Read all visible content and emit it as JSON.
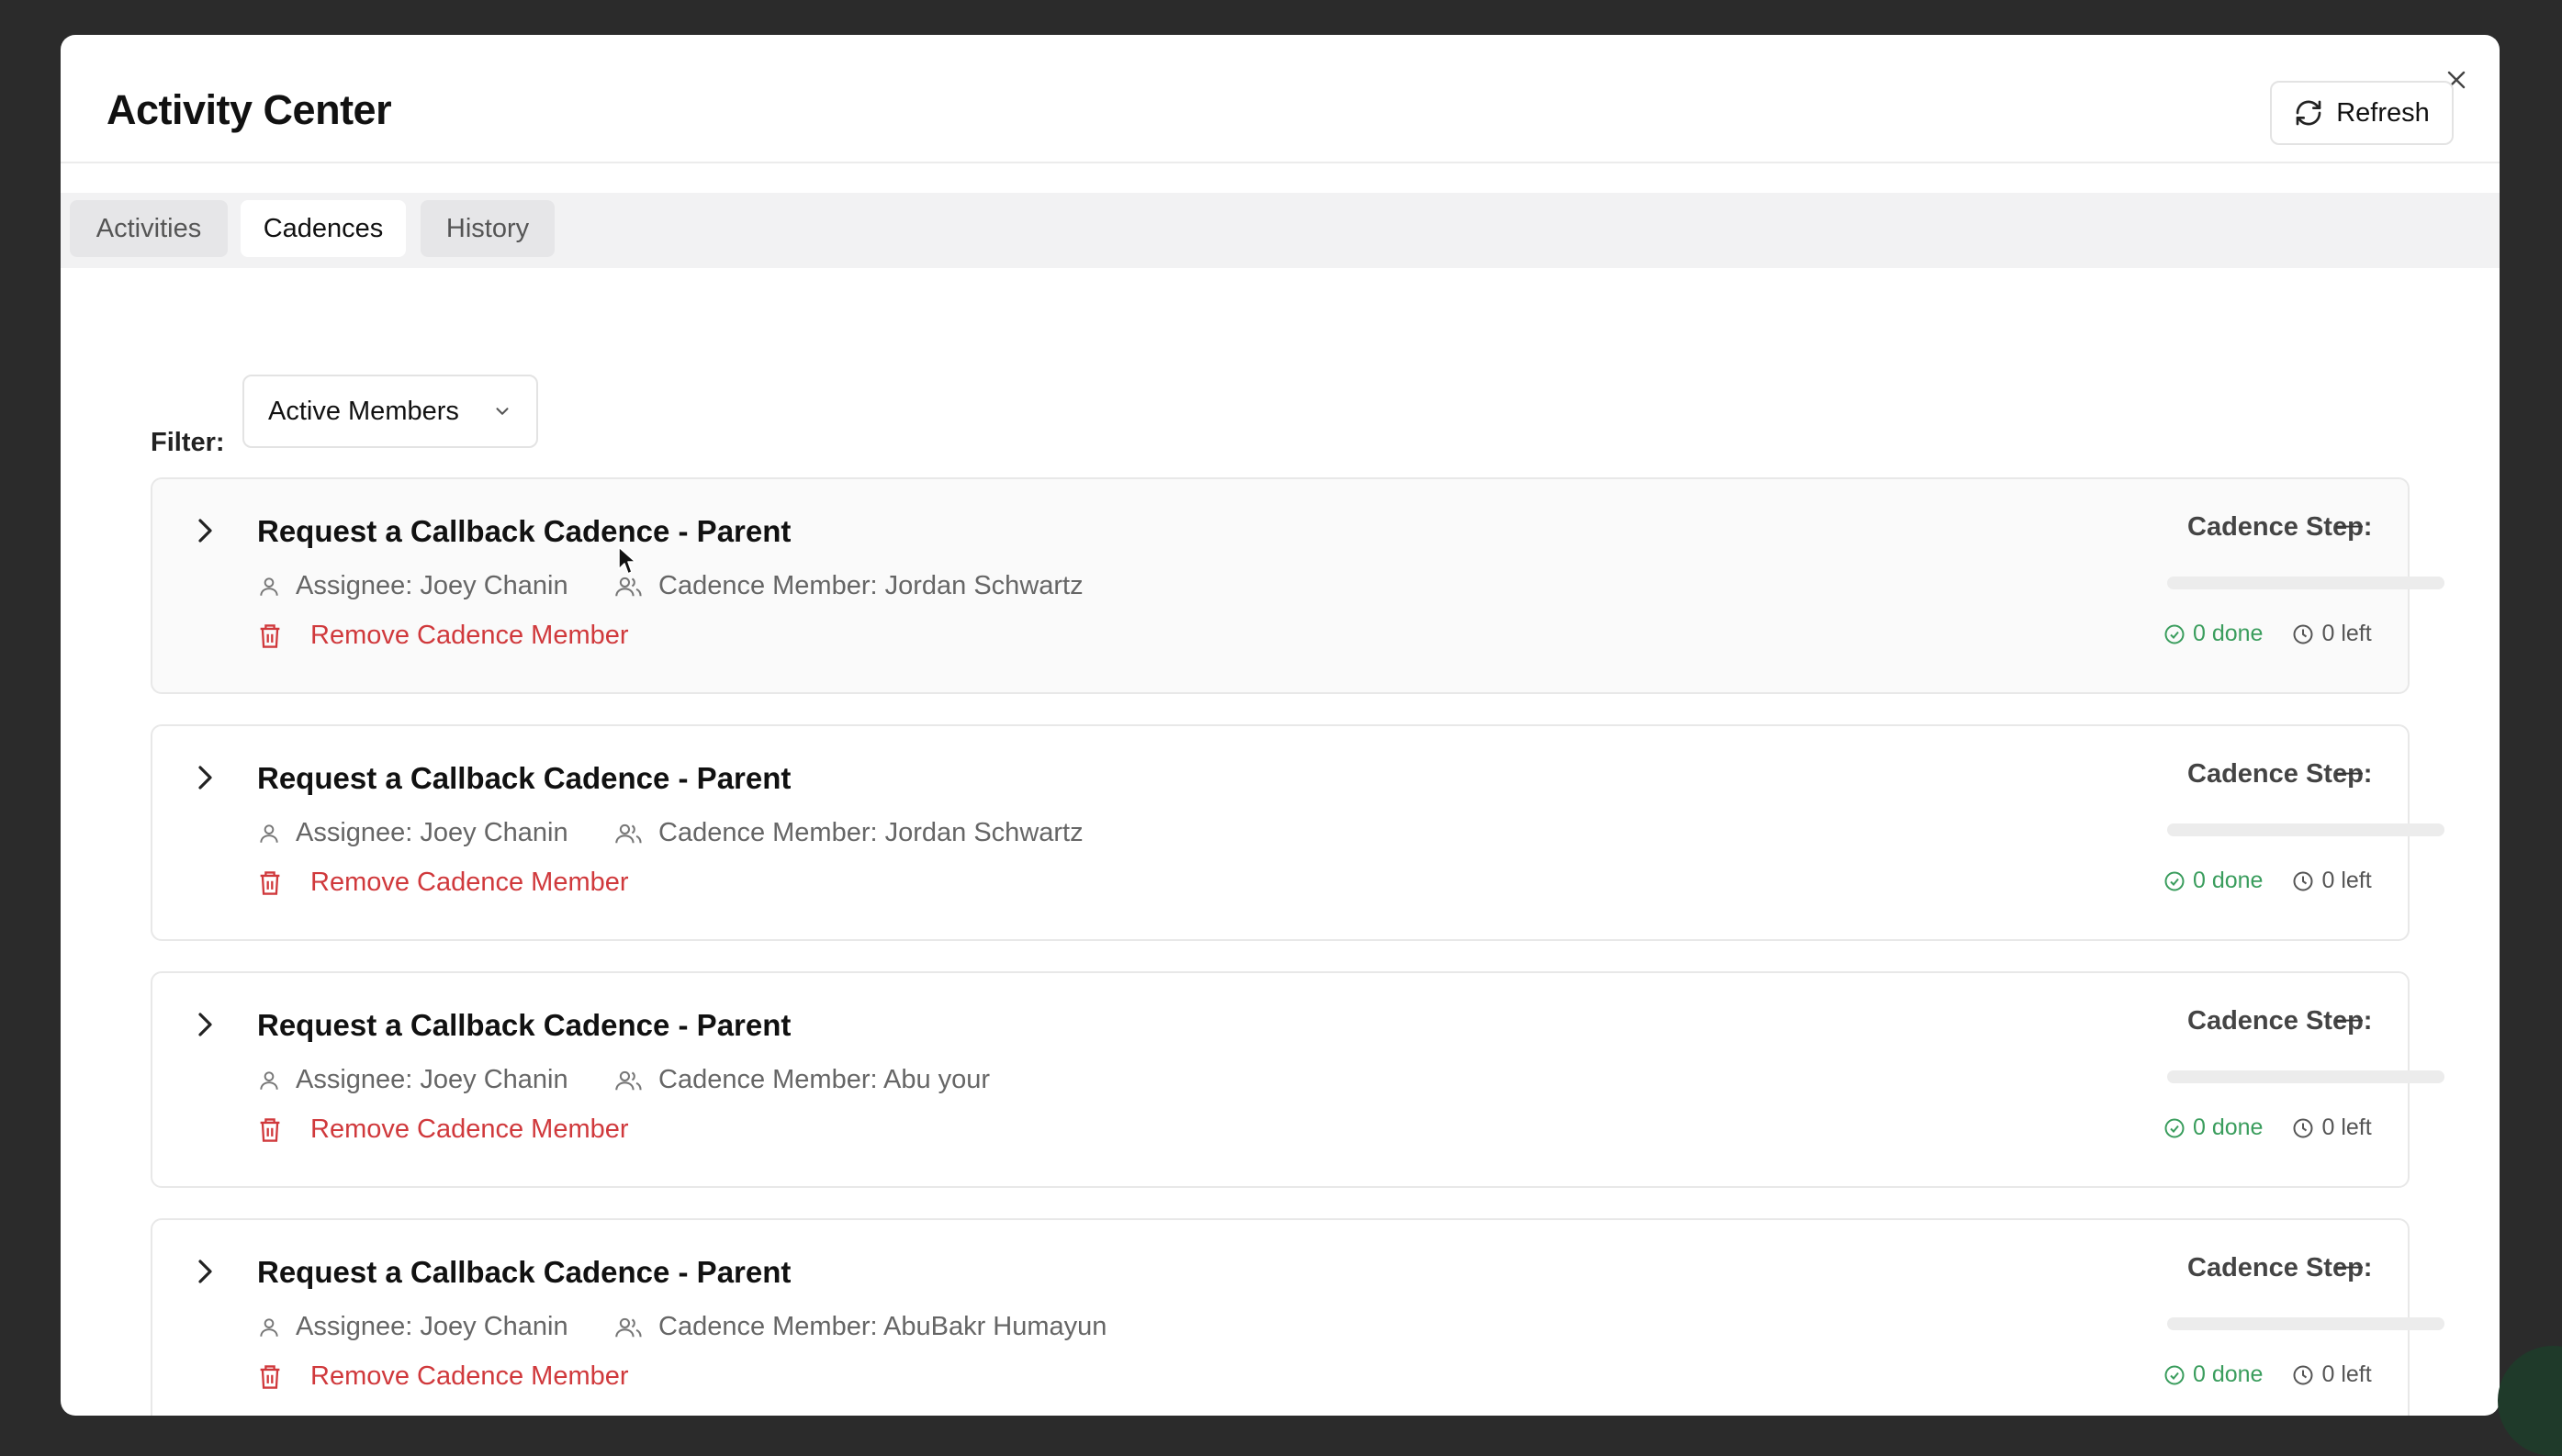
{
  "modal": {
    "title": "Activity Center",
    "refresh_label": "Refresh",
    "tabs": [
      {
        "label": "Activities"
      },
      {
        "label": "Cadences"
      },
      {
        "label": "History"
      }
    ],
    "active_tab": "Cadences",
    "filter": {
      "label": "Filter:",
      "value": "Active Members"
    },
    "cards": [
      {
        "title": "Request a Callback Cadence - Parent",
        "assignee": "Assignee: Joey Chanin",
        "member": "Cadence Member: Jordan Schwartz",
        "remove_label": "Remove Cadence Member",
        "step_label": "Cadence Step:",
        "step_value": "—",
        "progress": 0,
        "done": "0 done",
        "left": "0 left"
      },
      {
        "title": "Request a Callback Cadence - Parent",
        "assignee": "Assignee: Joey Chanin",
        "member": "Cadence Member: Jordan Schwartz",
        "remove_label": "Remove Cadence Member",
        "step_label": "Cadence Step:",
        "step_value": "—",
        "progress": 0,
        "done": "0 done",
        "left": "0 left"
      },
      {
        "title": "Request a Callback Cadence - Parent",
        "assignee": "Assignee: Joey Chanin",
        "member": "Cadence Member: Abu your",
        "remove_label": "Remove Cadence Member",
        "step_label": "Cadence Step:",
        "step_value": "—",
        "progress": 0,
        "done": "0 done",
        "left": "0 left"
      },
      {
        "title": "Request a Callback Cadence - Parent",
        "assignee": "Assignee: Joey Chanin",
        "member": "Cadence Member: AbuBakr Humayun",
        "remove_label": "Remove Cadence Member",
        "step_label": "Cadence Step:",
        "step_value": "—",
        "progress": 0,
        "done": "0 done",
        "left": "0 left"
      }
    ]
  },
  "colors": {
    "backdrop": "#2b2b2b",
    "danger": "#d0393c",
    "success": "#3a9d5d"
  }
}
